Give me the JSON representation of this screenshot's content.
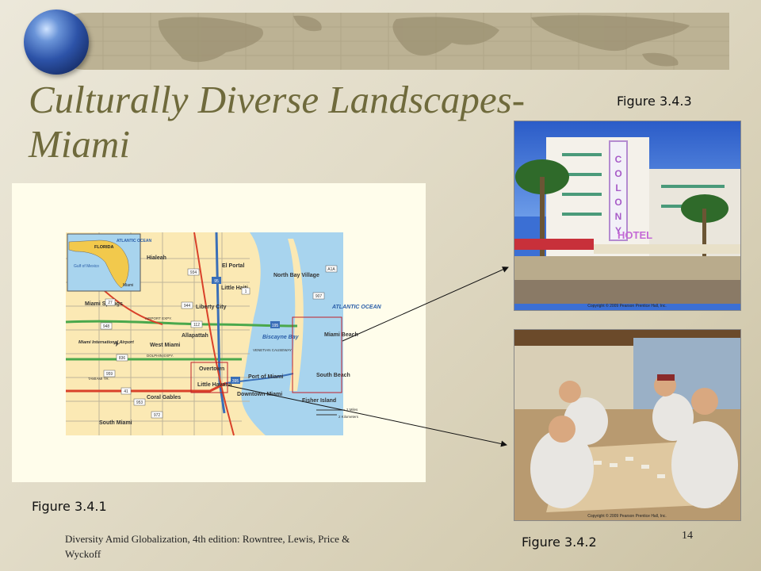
{
  "slide": {
    "title": "Culturally Diverse Landscapes-Miami",
    "page_number": "14",
    "footer": "Diversity Amid Globalization, 4th edition:  Rowntree, Lewis, Price & Wyckoff"
  },
  "figures": {
    "map_label": "Figure 3.4.1",
    "dominoes_label": "Figure 3.4.2",
    "hotel_label": "Figure 3.4.3"
  },
  "photos": {
    "hotel_sign": "COLONY",
    "hotel_word": "HOTEL",
    "copyright": "Copyright © 2009 Pearson Prentice Hall, Inc."
  },
  "map": {
    "inset": {
      "ocean": "ATLANTIC OCEAN",
      "state": "FLORIDA",
      "gulf": "Gulf of Mexico",
      "city": "Miami"
    },
    "places": [
      "Hialeah",
      "El Portal",
      "North Bay Village",
      "Little Haiti",
      "Miami Springs",
      "Liberty City",
      "Miami International Airport",
      "West Miami",
      "Allapattah",
      "Biscayne Bay",
      "Miami Beach",
      "Overtown",
      "Little Havana",
      "Port of Miami",
      "South Beach",
      "Coral Gables",
      "Downtown Miami",
      "Fisher Island",
      "South Miami"
    ],
    "ocean": "ATLANTIC OCEAN",
    "roads": [
      "AIRPORT EXPY.",
      "DOLPHIN EXPY.",
      "TAMIAMI TR.",
      "VENETIAN CAUSEWAY"
    ],
    "route_shields": [
      "934",
      "95",
      "1",
      "944",
      "112",
      "27",
      "948",
      "836",
      "959",
      "41",
      "953",
      "972",
      "907",
      "A1A",
      "195",
      "395"
    ],
    "scale": {
      "miles": "2 Miles",
      "km": "2 Kilometers"
    }
  }
}
